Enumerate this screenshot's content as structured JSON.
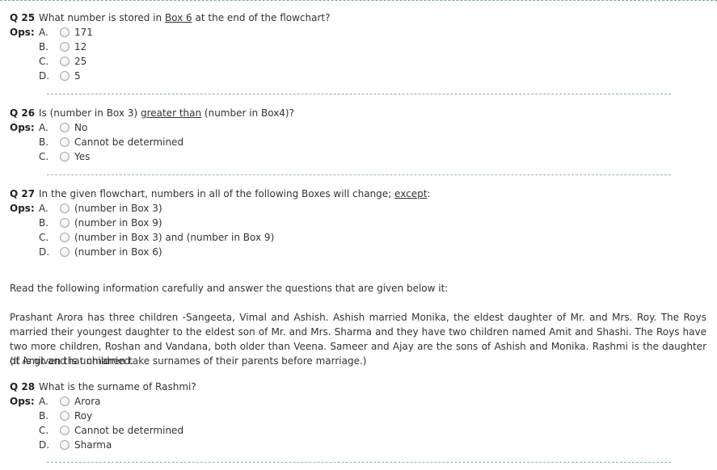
{
  "ops_label": "Ops:",
  "q25": {
    "number": "Q 25",
    "text_before": "What number is stored in ",
    "text_link": "Box 6",
    "text_after": " at the end of the flowchart?",
    "options": [
      {
        "letter": "A.",
        "text": "171"
      },
      {
        "letter": "B.",
        "text": "12"
      },
      {
        "letter": "C.",
        "text": "25"
      },
      {
        "letter": "D.",
        "text": "5"
      }
    ]
  },
  "q26": {
    "number": "Q 26",
    "text_before": "Is (number in Box 3) ",
    "text_link": "greater than",
    "text_after": " (number in Box4)?",
    "options": [
      {
        "letter": "A.",
        "text": "No"
      },
      {
        "letter": "B.",
        "text": "Cannot be determined"
      },
      {
        "letter": "C.",
        "text": "Yes"
      }
    ]
  },
  "q27": {
    "number": "Q 27",
    "text_before": "In the given flowchart, numbers in all of the following Boxes will change; ",
    "text_link": "except",
    "text_after": ":",
    "options": [
      {
        "letter": "A.",
        "text": "(number in Box 3)"
      },
      {
        "letter": "B.",
        "text": "(number in Box 9)"
      },
      {
        "letter": "C.",
        "text": "(number in Box 3) and (number in Box 9)"
      },
      {
        "letter": "D.",
        "text": "(number in Box 6)"
      }
    ]
  },
  "passage": {
    "intro": "Read the following information carefully and answer the questions that are given below it:",
    "body": "Prashant Arora has three children -Sangeeta, Vimal and Ashish. Ashish married Monika, the eldest daughter of Mr. and Mrs. Roy. The Roys married their youngest daughter to the eldest son of Mr. and Mrs. Sharma and they have two children named Amit and Shashi. The Roys have two more children, Roshan and Vandana, both older than Veena. Sameer and Ajay are the sons of Ashish and Monika. Rashmi is the daughter of Amit and is unmarried.",
    "note": "(It is given that children take surnames of their parents before marriage.)"
  },
  "q28": {
    "number": "Q 28",
    "text": "What is the surname of Rashmi?",
    "options": [
      {
        "letter": "A.",
        "text": "Arora"
      },
      {
        "letter": "B.",
        "text": "Roy"
      },
      {
        "letter": "C.",
        "text": "Cannot be determined"
      },
      {
        "letter": "D.",
        "text": "Sharma"
      }
    ]
  }
}
